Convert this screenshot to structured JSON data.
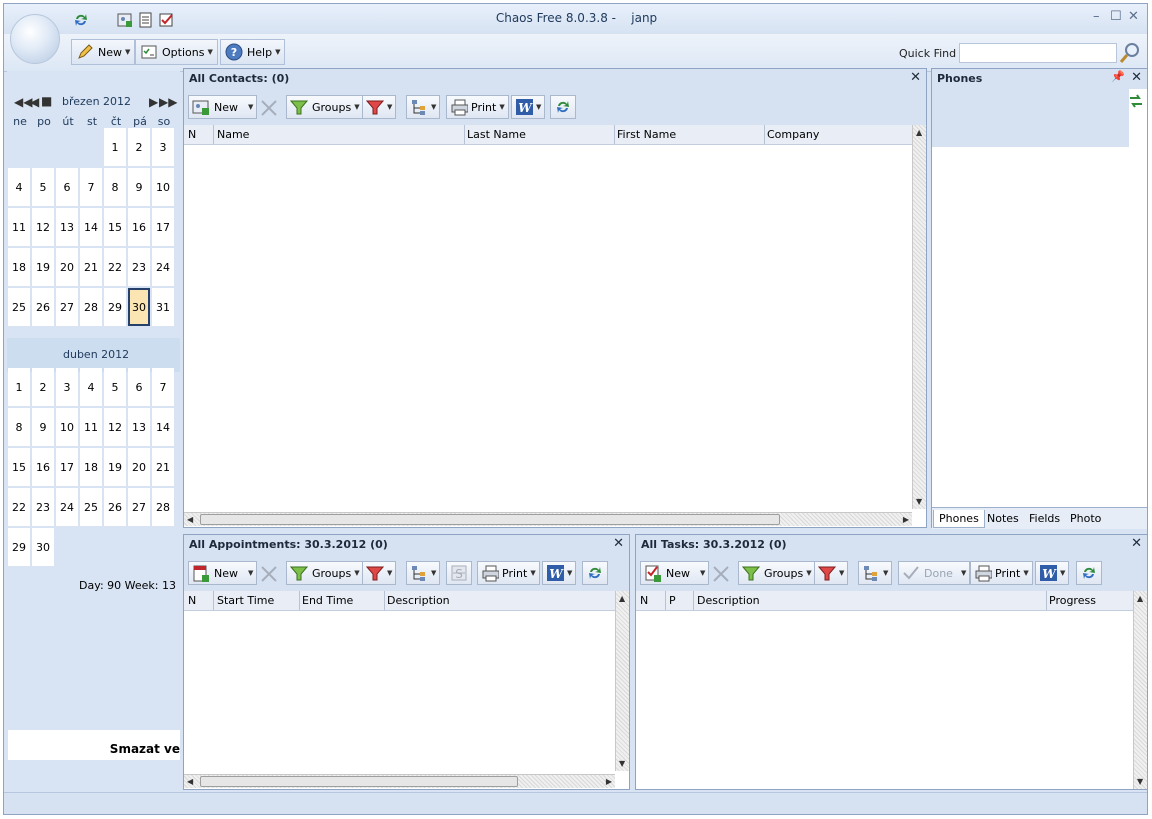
{
  "window": {
    "title": "Chaos Free 8.0.3.8 -",
    "user": "janp",
    "controls": [
      "–",
      "☐",
      "✕"
    ]
  },
  "menu": {
    "new_label": "New",
    "options_label": "Options",
    "help_label": "Help",
    "quickfind_label": "Quick Find",
    "quickfind_value": ""
  },
  "calendar": {
    "month1": "březen 2012",
    "month2": "duben 2012",
    "weekdays": [
      "ne",
      "po",
      "út",
      "st",
      "čt",
      "pá",
      "so"
    ],
    "month1_days": [
      [
        "",
        "",
        "",
        "",
        "1",
        "2",
        "3"
      ],
      [
        "4",
        "5",
        "6",
        "7",
        "8",
        "9",
        "10"
      ],
      [
        "11",
        "12",
        "13",
        "14",
        "15",
        "16",
        "17"
      ],
      [
        "18",
        "19",
        "20",
        "21",
        "22",
        "23",
        "24"
      ],
      [
        "25",
        "26",
        "27",
        "28",
        "29",
        "30",
        "31"
      ]
    ],
    "month2_days": [
      [
        "1",
        "2",
        "3",
        "4",
        "5",
        "6",
        "7"
      ],
      [
        "8",
        "9",
        "10",
        "11",
        "12",
        "13",
        "14"
      ],
      [
        "15",
        "16",
        "17",
        "18",
        "19",
        "20",
        "21"
      ],
      [
        "22",
        "23",
        "24",
        "25",
        "26",
        "27",
        "28"
      ],
      [
        "29",
        "30",
        "",
        "",
        "",
        "",
        ""
      ]
    ],
    "selected_day": "30",
    "day_week": "Day: 90  Week: 13",
    "bottom_text": "Smazat ve"
  },
  "contacts": {
    "title": "All Contacts:  (0)",
    "toolbar": {
      "new": "New",
      "groups": "Groups",
      "print": "Print"
    },
    "columns": [
      "N",
      "Name",
      "Last Name",
      "First Name",
      "Company"
    ]
  },
  "phones": {
    "title": "Phones",
    "tabs": [
      "Phones",
      "Notes",
      "Fields",
      "Photo"
    ]
  },
  "appointments": {
    "title": "All Appointments: 30.3.2012  (0)",
    "toolbar": {
      "new": "New",
      "groups": "Groups",
      "print": "Print"
    },
    "columns": [
      "N",
      "Start Time",
      "End Time",
      "Description"
    ]
  },
  "tasks": {
    "title": "All Tasks: 30.3.2012  (0)",
    "toolbar": {
      "new": "New",
      "groups": "Groups",
      "done": "Done",
      "print": "Print"
    },
    "columns": [
      "N",
      "P",
      "Description",
      "Progress"
    ]
  },
  "colors": {
    "accent": "#d6e2f2",
    "selection": "#fbe6b3",
    "border": "#8fa4c2"
  }
}
